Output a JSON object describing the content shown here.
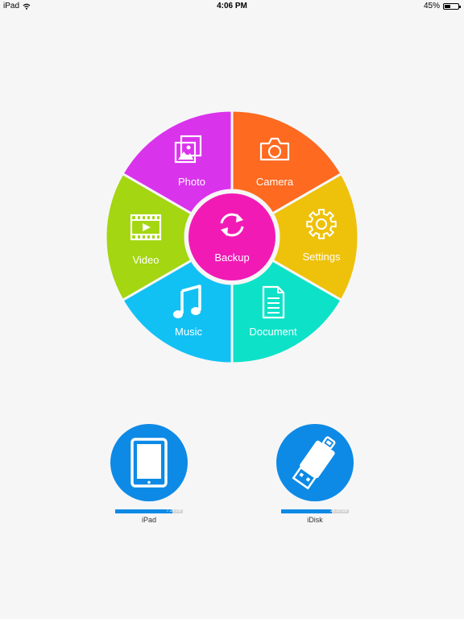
{
  "status_bar": {
    "device": "iPad",
    "time": "4:06 PM",
    "battery": "45%",
    "battery_level": 0.45
  },
  "wheel": {
    "center_label": "Backup",
    "center_color": "#f21ab5",
    "segments": [
      {
        "id": "photo",
        "label": "Photo",
        "color": "#da33ec",
        "icon": "photo-icon"
      },
      {
        "id": "camera",
        "label": "Camera",
        "color": "#fd6a20",
        "icon": "camera-icon"
      },
      {
        "id": "settings",
        "label": "Settings",
        "color": "#eec10b",
        "icon": "gear-icon"
      },
      {
        "id": "document",
        "label": "Document",
        "color": "#0de2c8",
        "icon": "document-icon"
      },
      {
        "id": "music",
        "label": "Music",
        "color": "#12c1f4",
        "icon": "music-icon"
      },
      {
        "id": "video",
        "label": "Video",
        "color": "#a4d611",
        "icon": "video-icon"
      }
    ]
  },
  "devices": [
    {
      "id": "ipad",
      "label": "iPad",
      "capacity_text": "7.38 GB",
      "usage_fraction": 0.85,
      "icon": "tablet-icon"
    },
    {
      "id": "idisk",
      "label": "iDisk",
      "capacity_text": "33.13 GB",
      "usage_fraction": 0.75,
      "icon": "usb-drive-icon"
    }
  ],
  "colors": {
    "device_blue": "#0d8ae5",
    "background": "#f6f6f7"
  }
}
